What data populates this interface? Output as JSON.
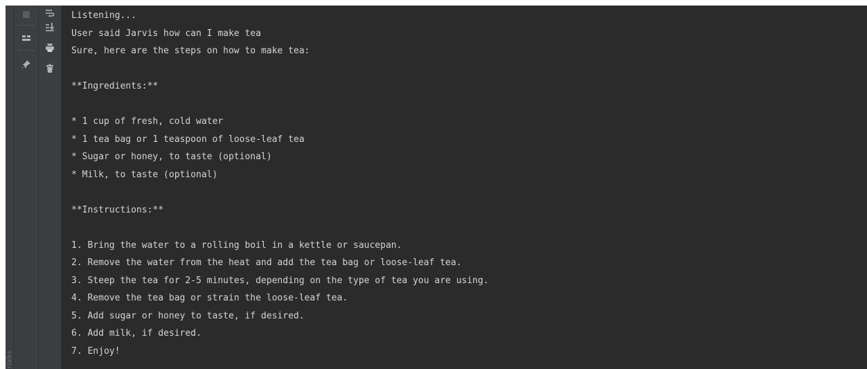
{
  "sidebar": {
    "outer_label": "rtalks"
  },
  "toolbar": {
    "icons": [
      "stop-icon",
      "soft-wrap-icon",
      "layout-icon",
      "scroll-to-end-icon",
      "pin-icon",
      "print-icon",
      "trash-icon"
    ]
  },
  "console": {
    "lines": [
      "Listening...",
      "User said Jarvis how can I make tea",
      "Sure, here are the steps on how to make tea:",
      "",
      "**Ingredients:**",
      "",
      "* 1 cup of fresh, cold water",
      "* 1 tea bag or 1 teaspoon of loose-leaf tea",
      "* Sugar or honey, to taste (optional)",
      "* Milk, to taste (optional)",
      "",
      "**Instructions:**",
      "",
      "1. Bring the water to a rolling boil in a kettle or saucepan.",
      "2. Remove the water from the heat and add the tea bag or loose-leaf tea.",
      "3. Steep the tea for 2-5 minutes, depending on the type of tea you are using.",
      "4. Remove the tea bag or strain the loose-leaf tea.",
      "5. Add sugar or honey to taste, if desired.",
      "6. Add milk, if desired.",
      "7. Enjoy!"
    ]
  },
  "colors": {
    "background": "#2b2b2b",
    "toolbar": "#3c3f41",
    "text": "#d4d4d4",
    "icon": "#afb1b3"
  }
}
